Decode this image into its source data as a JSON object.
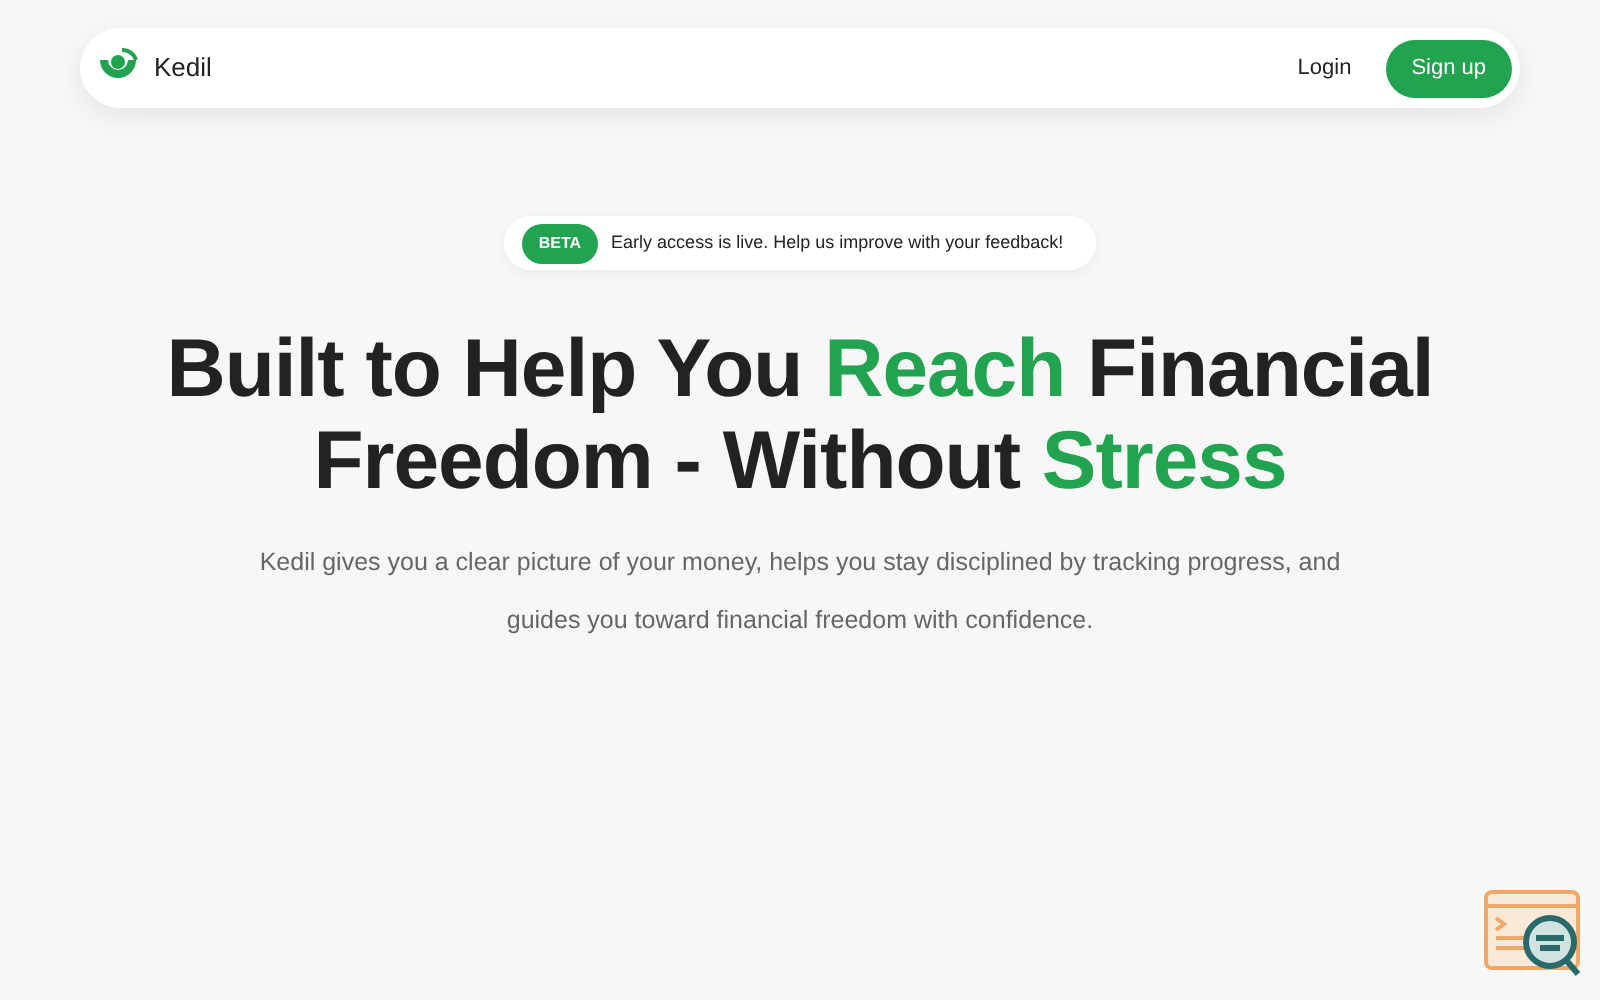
{
  "navbar": {
    "brand": "Kedil",
    "login": "Login",
    "signup": "Sign up"
  },
  "announcement": {
    "badge": "BETA",
    "text": "Early access is live. Help us improve with your feedback!"
  },
  "headline": [
    [
      {
        "text": "Built to Help You ",
        "highlight": false
      },
      {
        "text": "Reach",
        "highlight": true
      },
      {
        "text": " Financial",
        "highlight": false
      }
    ],
    [
      {
        "text": "Freedom - Without ",
        "highlight": false
      },
      {
        "text": "Stress",
        "highlight": true
      }
    ]
  ],
  "subheadline": "Kedil gives you a clear picture of your money, helps you stay disciplined by tracking progress, and guides you toward financial freedom with confidence."
}
